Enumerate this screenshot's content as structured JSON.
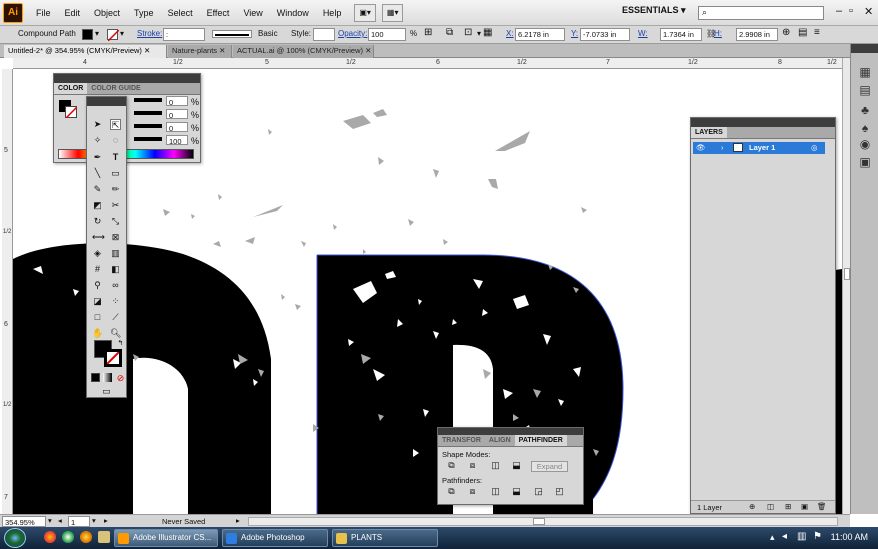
{
  "app": {
    "logo": "Ai"
  },
  "menu": [
    "File",
    "Edit",
    "Object",
    "Type",
    "Select",
    "Effect",
    "View",
    "Window",
    "Help"
  ],
  "workspace": {
    "label": "ESSENTIALS ▾",
    "search_placeholder": ""
  },
  "control_bar": {
    "selection": "Compound Path",
    "stroke_label": "Stroke:",
    "brush": "Basic",
    "style_label": "Style:",
    "opacity_label": "Opacity:",
    "opacity_value": "100",
    "opacity_unit": "%",
    "x_label": "X:",
    "x_value": "6.2178 in",
    "y_label": "Y:",
    "y_value": "-7.0733 in",
    "w_label": "W:",
    "w_value": "1.7364 in",
    "h_label": "H:",
    "h_value": "2.9908 in"
  },
  "tabs": [
    {
      "label": "Untitled-2* @ 354.95% (CMYK/Preview)",
      "active": true
    },
    {
      "label": "Nature-plants",
      "active": false
    },
    {
      "label": "ACTUAL.ai @ 100% (CMYK/Preview)",
      "active": false
    }
  ],
  "ruler": {
    "h": [
      "4",
      "1/2",
      "5",
      "1/2",
      "6",
      "1/2",
      "7",
      "1/2",
      "8",
      "1/2"
    ],
    "v": [
      "5",
      "1/2",
      "6",
      "1/2",
      "7"
    ]
  },
  "color_panel": {
    "tabs": [
      "COLOR",
      "COLOR GUIDE"
    ],
    "sliders": [
      {
        "value": "0"
      },
      {
        "value": "0"
      },
      {
        "value": "0"
      },
      {
        "value": "100"
      }
    ],
    "unit": "%"
  },
  "layers_panel": {
    "tab": "LAYERS",
    "layer_name": "Layer 1",
    "footer": "1 Layer"
  },
  "pathfinder_panel": {
    "tabs": [
      "TRANSFOR",
      "ALIGN",
      "PATHFINDER"
    ],
    "shape_modes": "Shape Modes:",
    "expand": "Expand",
    "pathfinders": "Pathfinders:"
  },
  "status": {
    "zoom": "354.95%",
    "page": "1",
    "info": "Never Saved"
  },
  "taskbar": {
    "items": [
      {
        "label": "Adobe Illustrator CS...",
        "active": true,
        "color": "#ff9a00"
      },
      {
        "label": "Adobe Photoshop",
        "active": false,
        "color": "#2f7de0"
      },
      {
        "label": "PLANTS",
        "active": false,
        "color": "#e6c24a"
      }
    ],
    "clock": "11:00 AM"
  },
  "colors": {
    "selection": "#3b55d6",
    "layer_highlight": "#2b7ad8",
    "artwork": "#000000",
    "speckle": "#a9a9a9"
  }
}
